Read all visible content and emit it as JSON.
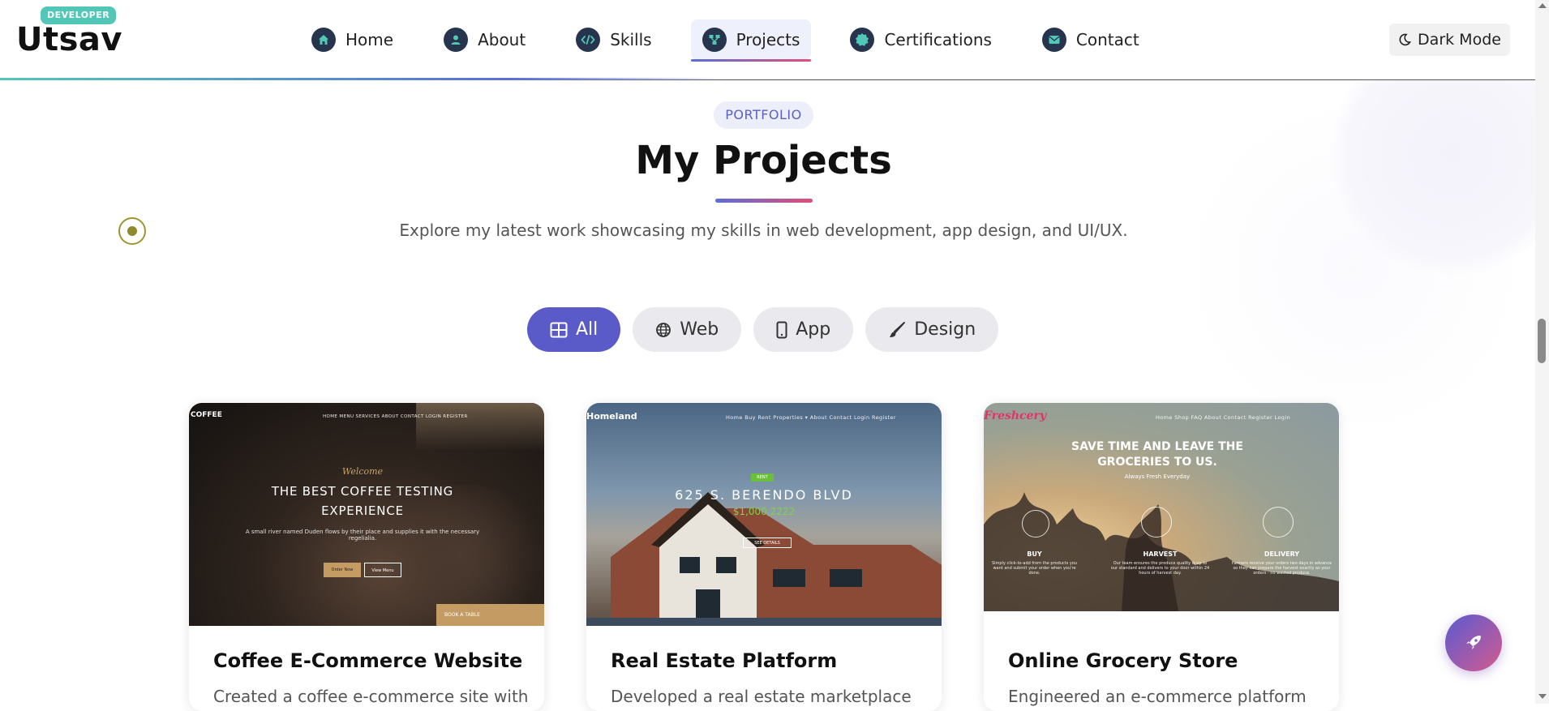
{
  "header": {
    "badge": "DEVELOPER",
    "logo": "Utsav",
    "nav": [
      {
        "label": "Home",
        "icon": "home-icon"
      },
      {
        "label": "About",
        "icon": "user-icon"
      },
      {
        "label": "Skills",
        "icon": "code-icon"
      },
      {
        "label": "Projects",
        "icon": "project-diagram-icon",
        "active": true
      },
      {
        "label": "Certifications",
        "icon": "certificate-icon"
      },
      {
        "label": "Contact",
        "icon": "envelope-icon"
      }
    ],
    "dark_mode_label": "Dark Mode"
  },
  "section": {
    "tag": "PORTFOLIO",
    "title": "My Projects",
    "subtitle": "Explore my latest work showcasing my skills in web development, app design, and UI/UX."
  },
  "filters": [
    {
      "label": "All",
      "icon": "grid-icon",
      "active": true
    },
    {
      "label": "Web",
      "icon": "globe-icon"
    },
    {
      "label": "App",
      "icon": "mobile-icon"
    },
    {
      "label": "Design",
      "icon": "brush-icon"
    }
  ],
  "projects": [
    {
      "title": "Coffee E-Commerce Website",
      "desc": "Created a coffee e-commerce site with",
      "thumb": {
        "logo": "COFFEE",
        "nav": "HOME   MENU   SERVICES   ABOUT   CONTACT   LOGIN   REGISTER",
        "welcome": "Welcome",
        "headline1": "THE BEST COFFEE TESTING",
        "headline2": "EXPERIENCE",
        "body": "A small river named Duden flows by their place and supplies it with the necessary regelialia.",
        "btn1": "Order Now",
        "btn2": "View Menu",
        "book": "BOOK A TABLE"
      }
    },
    {
      "title": "Real Estate Platform",
      "desc": "Developed a real estate marketplace",
      "thumb": {
        "logo": "Homeland",
        "nav": "Home   Buy   Rent   Properties ▾   About   Contact   Login   Register",
        "badge": "RENT",
        "address": "625 S. BERENDO BLVD",
        "price": "$1,000,2222",
        "btn": "SEE DETAILS"
      }
    },
    {
      "title": "Online Grocery Store",
      "desc": "Engineered an e-commerce platform",
      "thumb": {
        "logo": "Freshcery",
        "nav": "Home   Shop   FAQ   About   Contact   Register   Login",
        "headline1": "SAVE TIME AND LEAVE THE",
        "headline2": "GROCERIES TO US.",
        "tagline": "Always Fresh Everyday",
        "features": [
          {
            "title": "BUY",
            "text": "Simply click-to-add from the products you want and submit your order when you're done."
          },
          {
            "title": "HARVEST",
            "text": "Our team ensures the produce quality is up to our standard and delivers to your door within 24 hours of harvest day."
          },
          {
            "title": "DELIVERY",
            "text": "Farmers receive your orders two days in advance so they can prepare the harvest exactly as your orders - no wasted produce."
          }
        ]
      }
    }
  ],
  "colors": {
    "accent": "#5a5bc8",
    "teal": "#52c7b8",
    "pink": "#e04e7b",
    "nav_icon_bg": "#26354d"
  }
}
